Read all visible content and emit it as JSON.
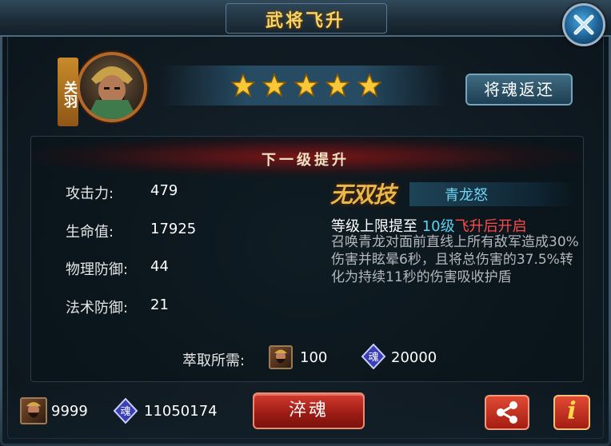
{
  "title": "武将飞升",
  "hero": {
    "name": "关羽",
    "stars": 5
  },
  "return_button": "将魂返还",
  "section_title": "下一级提升",
  "stats": [
    {
      "label": "攻击力:",
      "value": "479"
    },
    {
      "label": "生命值:",
      "value": "17925"
    },
    {
      "label": "物理防御:",
      "value": "44"
    },
    {
      "label": "法术防御:",
      "value": "21"
    }
  ],
  "skill": {
    "badge": "无双技",
    "name": "青龙怒",
    "level_prefix": "等级上限提至",
    "level_value": "10级",
    "level_suffix": "飞升后开启",
    "description": "召唤青龙对面前直线上所有敌军造成30%伤害并眩晕6秒，且将总伤害的37.5%转化为持续11秒的伤害吸收护盾"
  },
  "requirement": {
    "label": "萃取所需:",
    "hero_soul_amount": "100",
    "soul_amount": "20000"
  },
  "inventory": {
    "hero_soul_count": "9999",
    "soul_count": "11050174"
  },
  "cuihun_button": "淬魂",
  "info_button": "i",
  "icons": [
    "close-icon",
    "star-icon",
    "soul-icon",
    "share-icon",
    "info-icon"
  ],
  "colors": {
    "gold": "#f4d46a",
    "skill_blue": "#58d3f2",
    "red": "#ff4b4b"
  }
}
